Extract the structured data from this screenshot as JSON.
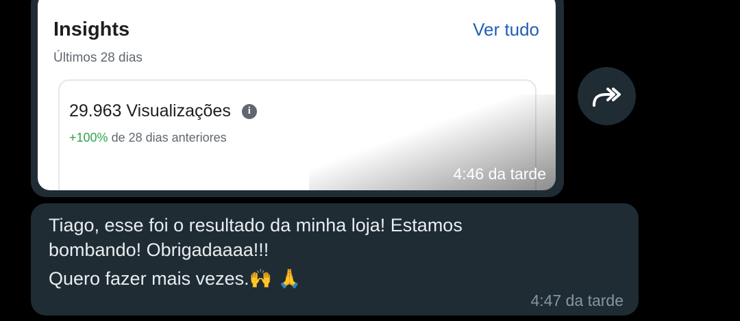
{
  "image_message": {
    "card": {
      "title": "Insights",
      "link": "Ver tudo",
      "subtitle": "Últimos 28 dias",
      "metric": "29.963 Visualizações",
      "delta_positive": "+100%",
      "delta_rest": " de 28 dias anteriores"
    },
    "time": "4:46 da tarde"
  },
  "forward_icon": "forward-arrow-icon",
  "text_message": {
    "line1": "Tiago, esse foi o resultado da minha loja! Estamos",
    "line2": "bombando! Obrigadaaaa!!!",
    "line3": "Quero fazer mais vezes.",
    "emojis": "🙌 🙏",
    "time": "4:47 da tarde"
  },
  "colors": {
    "background": "#000000",
    "bubble": "#1f2c34",
    "link": "#1f5fb5",
    "positive": "#31a24c",
    "timestamp": "#8696a0"
  }
}
